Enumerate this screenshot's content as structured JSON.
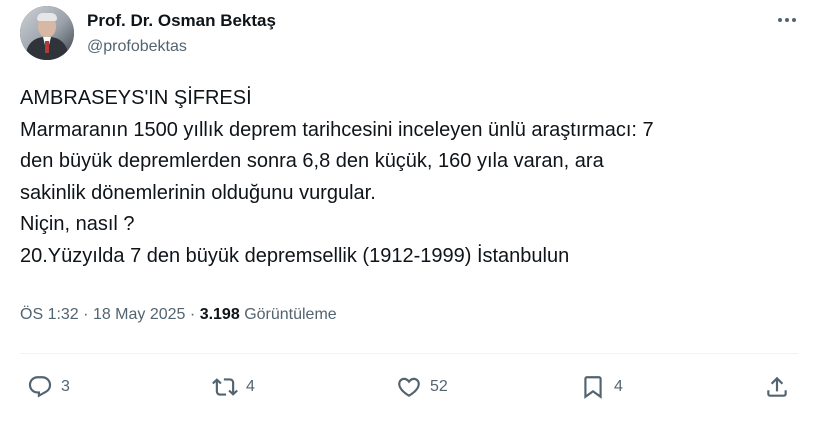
{
  "author": {
    "display_name": "Prof. Dr. Osman Bektaş",
    "handle": "@profobektas",
    "avatar_icon": "profile-photo"
  },
  "post": {
    "lines": [
      "AMBRASEYS'IN ŞİFRESİ",
      "Marmaranın 1500 yıllık deprem tarihcesini inceleyen ünlü araştırmacı: 7",
      "den büyük depremlerden sonra 6,8 den küçük, 160 yıla varan, ara",
      "sakinlik dönemlerinin olduğunu vurgular.",
      "Niçin, nasıl ?",
      "20.Yüzyılda 7 den büyük depremsellik (1912-1999) İstanbulun"
    ]
  },
  "meta": {
    "time": "ÖS 1:32",
    "date": "18 May 2025",
    "views": "3.198",
    "views_label": "Görüntüleme",
    "separator": "·"
  },
  "actions": {
    "reply_count": "3",
    "repost_count": "4",
    "like_count": "52",
    "bookmark_count": "4"
  },
  "colors": {
    "text_primary": "#0f1419",
    "text_secondary": "#536471",
    "divider": "#eff3f4",
    "background": "#ffffff"
  }
}
